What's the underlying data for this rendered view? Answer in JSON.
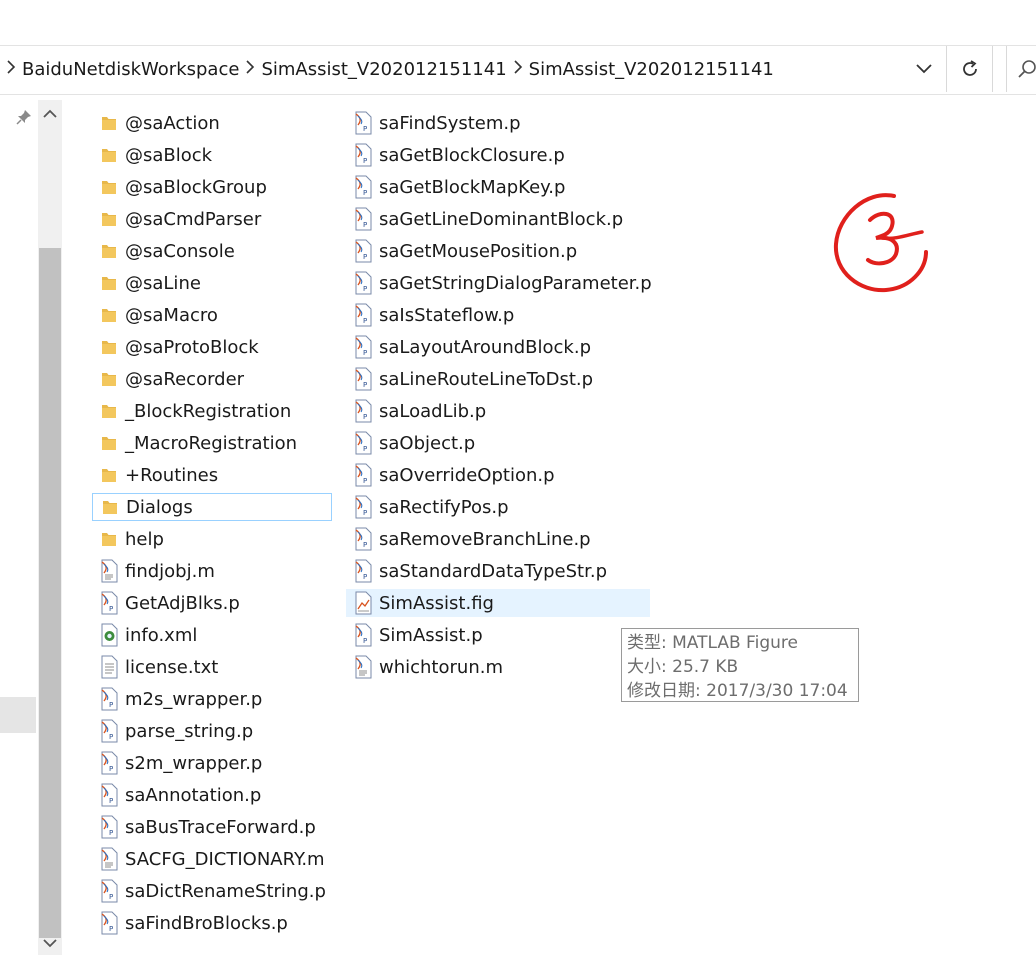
{
  "breadcrumb": [
    "BaiduNetdiskWorkspace",
    "SimAssist_V202012151141",
    "SimAssist_V202012151141"
  ],
  "files_col1": [
    {
      "name": "@saAction",
      "type": "folder"
    },
    {
      "name": "@saBlock",
      "type": "folder"
    },
    {
      "name": "@saBlockGroup",
      "type": "folder"
    },
    {
      "name": "@saCmdParser",
      "type": "folder"
    },
    {
      "name": "@saConsole",
      "type": "folder"
    },
    {
      "name": "@saLine",
      "type": "folder"
    },
    {
      "name": "@saMacro",
      "type": "folder"
    },
    {
      "name": "@saProtoBlock",
      "type": "folder"
    },
    {
      "name": "@saRecorder",
      "type": "folder"
    },
    {
      "name": "_BlockRegistration",
      "type": "folder"
    },
    {
      "name": "_MacroRegistration",
      "type": "folder"
    },
    {
      "name": "+Routines",
      "type": "folder"
    },
    {
      "name": "Dialogs",
      "type": "folder"
    },
    {
      "name": "help",
      "type": "folder"
    },
    {
      "name": "findjobj.m",
      "type": "m"
    },
    {
      "name": "GetAdjBlks.p",
      "type": "p"
    },
    {
      "name": "info.xml",
      "type": "xml"
    },
    {
      "name": "license.txt",
      "type": "txt"
    },
    {
      "name": "m2s_wrapper.p",
      "type": "p"
    },
    {
      "name": "parse_string.p",
      "type": "p"
    },
    {
      "name": "s2m_wrapper.p",
      "type": "p"
    },
    {
      "name": "saAnnotation.p",
      "type": "p"
    },
    {
      "name": "saBusTraceForward.p",
      "type": "p"
    },
    {
      "name": "SACFG_DICTIONARY.m",
      "type": "m"
    },
    {
      "name": "saDictRenameString.p",
      "type": "p"
    },
    {
      "name": "saFindBroBlocks.p",
      "type": "p"
    }
  ],
  "files_col2": [
    {
      "name": "saFindSystem.p",
      "type": "p"
    },
    {
      "name": "saGetBlockClosure.p",
      "type": "p"
    },
    {
      "name": "saGetBlockMapKey.p",
      "type": "p"
    },
    {
      "name": "saGetLineDominantBlock.p",
      "type": "p"
    },
    {
      "name": "saGetMousePosition.p",
      "type": "p"
    },
    {
      "name": "saGetStringDialogParameter.p",
      "type": "p"
    },
    {
      "name": "saIsStateflow.p",
      "type": "p"
    },
    {
      "name": "saLayoutAroundBlock.p",
      "type": "p"
    },
    {
      "name": "saLineRouteLineToDst.p",
      "type": "p"
    },
    {
      "name": "saLoadLib.p",
      "type": "p"
    },
    {
      "name": "saObject.p",
      "type": "p"
    },
    {
      "name": "saOverrideOption.p",
      "type": "p"
    },
    {
      "name": "saRectifyPos.p",
      "type": "p"
    },
    {
      "name": "saRemoveBranchLine.p",
      "type": "p"
    },
    {
      "name": "saStandardDataTypeStr.p",
      "type": "p"
    },
    {
      "name": "SimAssist.fig",
      "type": "fig"
    },
    {
      "name": "SimAssist.p",
      "type": "p"
    },
    {
      "name": "whichtorun.m",
      "type": "m"
    }
  ],
  "focused_item": "Dialogs",
  "hovered_item": "SimAssist.fig",
  "tooltip": {
    "line1": "类型: MATLAB Figure",
    "line2": "大小: 25.7 KB",
    "line3": "修改日期: 2017/3/30 17:04"
  },
  "annotation": {
    "color": "#e0201c",
    "label": "③"
  },
  "colors": {
    "folder": "#e8b84a",
    "selection_border": "#99d1ff",
    "hover_bg": "#e5f3ff"
  }
}
